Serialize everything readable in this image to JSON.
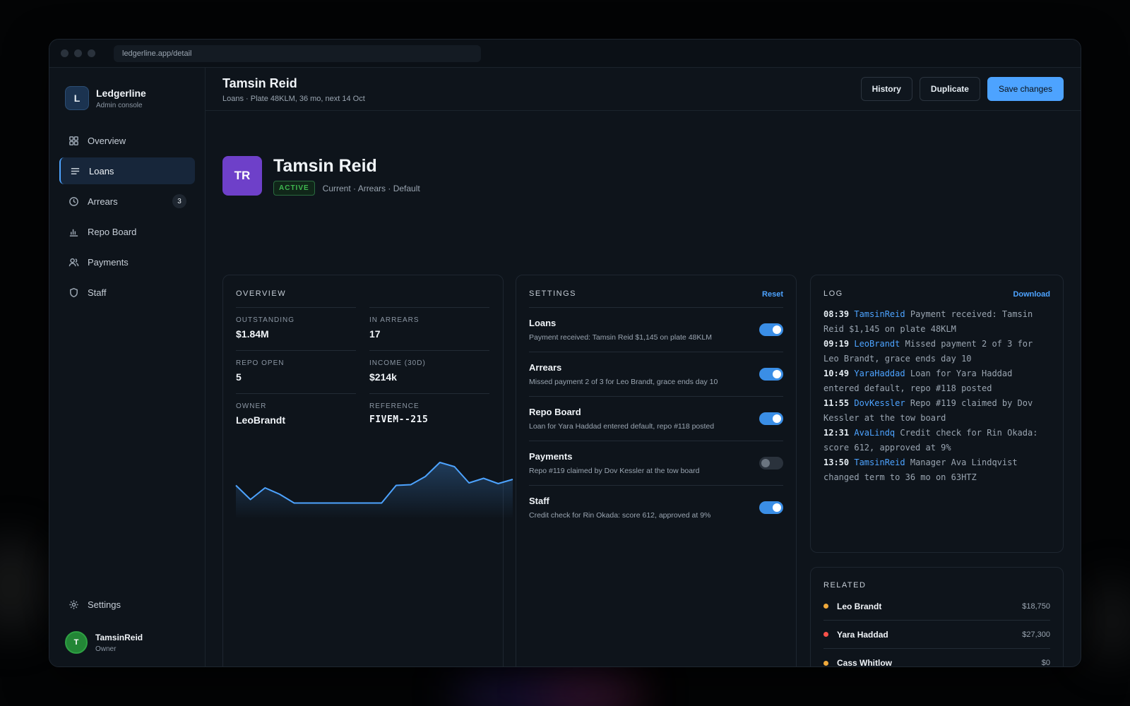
{
  "browser": {
    "url": "ledgerline.app/detail"
  },
  "brand": {
    "logo": "L",
    "name": "Ledgerline",
    "subtitle": "Admin console"
  },
  "sidebar": {
    "items": [
      {
        "label": "Overview",
        "icon": "grid-icon"
      },
      {
        "label": "Loans",
        "icon": "list-icon",
        "active": true
      },
      {
        "label": "Arrears",
        "icon": "clock-icon",
        "badge": "3"
      },
      {
        "label": "Repo Board",
        "icon": "bar-chart-icon"
      },
      {
        "label": "Payments",
        "icon": "users-icon"
      },
      {
        "label": "Staff",
        "icon": "shield-icon"
      }
    ],
    "settings_label": "Settings"
  },
  "user": {
    "initial": "T",
    "name": "TamsinReid",
    "role": "Owner"
  },
  "header": {
    "title": "Tamsin Reid",
    "subtitle": "Loans · Plate 48KLM, 36 mo, next 14 Oct",
    "buttons": {
      "history": "History",
      "duplicate": "Duplicate",
      "save": "Save changes"
    }
  },
  "profile": {
    "initials": "TR",
    "name": "Tamsin Reid",
    "status": "ACTIVE",
    "states": "Current · Arrears · Default"
  },
  "overview": {
    "title": "OVERVIEW",
    "stats": [
      {
        "label": "OUTSTANDING",
        "value": "$1.84M"
      },
      {
        "label": "IN ARREARS",
        "value": "17"
      },
      {
        "label": "REPO OPEN",
        "value": "5"
      },
      {
        "label": "INCOME (30D)",
        "value": "$214k"
      },
      {
        "label": "OWNER",
        "value": "LeoBrandt"
      },
      {
        "label": "REFERENCE",
        "value": "FIVEM--215"
      }
    ],
    "sparkline": [
      0.55,
      0.15,
      0.48,
      0.3,
      0.05,
      0.05,
      0.05,
      0.05,
      0.05,
      0.05,
      0.05,
      0.55,
      0.57,
      0.8,
      1.2,
      1.08,
      0.62,
      0.75,
      0.6,
      0.72
    ]
  },
  "settings": {
    "title": "SETTINGS",
    "reset_label": "Reset",
    "rows": [
      {
        "title": "Loans",
        "desc": "Payment received: Tamsin Reid $1,145 on plate 48KLM",
        "on": true
      },
      {
        "title": "Arrears",
        "desc": "Missed payment 2 of 3 for Leo Brandt, grace ends day 10",
        "on": true
      },
      {
        "title": "Repo Board",
        "desc": "Loan for Yara Haddad entered default, repo #118 posted",
        "on": true
      },
      {
        "title": "Payments",
        "desc": "Repo #119 claimed by Dov Kessler at the tow board",
        "on": false
      },
      {
        "title": "Staff",
        "desc": "Credit check for Rin Okada: score 612, approved at 9%",
        "on": true
      }
    ]
  },
  "log": {
    "title": "LOG",
    "download_label": "Download",
    "entries": [
      {
        "time": "08:39",
        "user": "TamsinReid",
        "text": "Payment received: Tamsin Reid $1,145 on plate 48KLM"
      },
      {
        "time": "09:19",
        "user": "LeoBrandt",
        "text": "Missed payment 2 of 3 for Leo Brandt, grace ends day 10"
      },
      {
        "time": "10:49",
        "user": "YaraHaddad",
        "text": "Loan for Yara Haddad entered default, repo #118 posted"
      },
      {
        "time": "11:55",
        "user": "DovKessler",
        "text": "Repo #119 claimed by Dov Kessler at the tow board"
      },
      {
        "time": "12:31",
        "user": "AvaLindq",
        "text": "Credit check for Rin Okada: score 612, approved at 9%"
      },
      {
        "time": "13:50",
        "user": "TamsinReid",
        "text": "Manager Ava Lindqvist changed term to 36 mo on 63HTZ"
      }
    ]
  },
  "related": {
    "title": "RELATED",
    "items": [
      {
        "name": "Leo Brandt",
        "amount": "$18,750",
        "color": "#f0a93b"
      },
      {
        "name": "Yara Haddad",
        "amount": "$27,300",
        "color": "#f85149"
      },
      {
        "name": "Cass Whitlow",
        "amount": "$0",
        "color": "#f0a93b"
      }
    ]
  },
  "colors": {
    "accent": "#4da3ff",
    "active": "#3fb950",
    "avatar": "#6e40c9"
  }
}
